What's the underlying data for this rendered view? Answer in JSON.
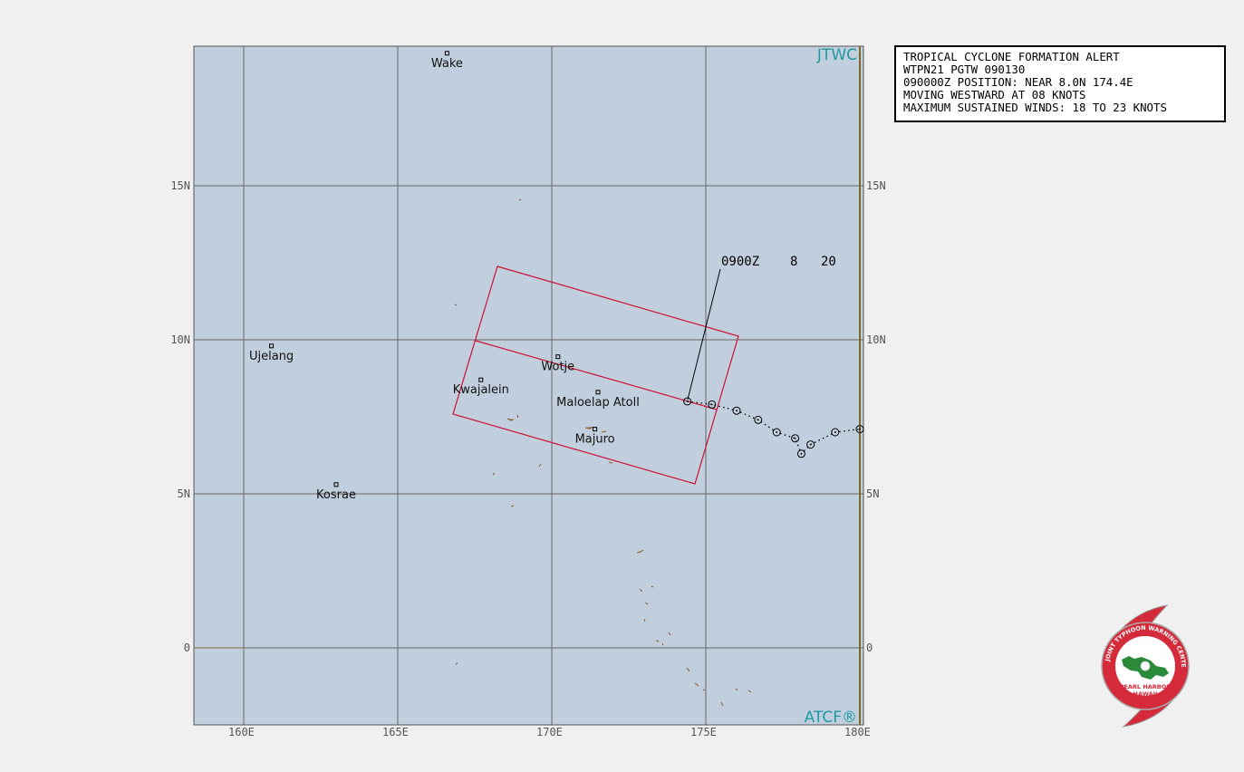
{
  "map": {
    "brand_top": "JTWC",
    "brand_bottom": "ATCF®",
    "colors": {
      "ocean": "#c0cedd",
      "background": "#f0f0f0",
      "grid": "#666666",
      "alert_area": "#cc1133",
      "land": "#8a5a2a"
    },
    "lon_ticks": [
      "160E",
      "165E",
      "170E",
      "175E",
      "180E"
    ],
    "lat_ticks_left": [
      "15N",
      "10N",
      "5N",
      "0"
    ],
    "lat_ticks_right": [
      "15N",
      "10N",
      "5N",
      "0"
    ],
    "places": [
      {
        "name": "Wake",
        "lat": 19.3,
        "lon": 166.6
      },
      {
        "name": "Ujelang",
        "lat": 9.8,
        "lon": 160.9
      },
      {
        "name": "Wotje",
        "lat": 9.45,
        "lon": 170.2
      },
      {
        "name": "Kwajalein",
        "lat": 8.7,
        "lon": 167.7
      },
      {
        "name": "Maloelap Atoll",
        "lat": 8.3,
        "lon": 171.5
      },
      {
        "name": "Majuro",
        "lat": 7.1,
        "lon": 171.4
      },
      {
        "name": "Kosrae",
        "lat": 5.3,
        "lon": 163.0
      }
    ],
    "track": [
      {
        "lat": 8.0,
        "lon": 174.4
      },
      {
        "lat": 7.9,
        "lon": 175.2
      },
      {
        "lat": 7.7,
        "lon": 176.0
      },
      {
        "lat": 7.4,
        "lon": 176.7
      },
      {
        "lat": 7.0,
        "lon": 177.3
      },
      {
        "lat": 6.8,
        "lon": 177.9
      },
      {
        "lat": 6.3,
        "lon": 178.1
      },
      {
        "lat": 6.6,
        "lon": 178.4
      },
      {
        "lat": 7.0,
        "lon": 179.2
      },
      {
        "lat": 7.1,
        "lon": 180.0
      }
    ],
    "fix_label": {
      "time": "0900Z",
      "lat_value": "8",
      "wind_value": "20"
    }
  },
  "alert": {
    "line1": "TROPICAL CYCLONE FORMATION ALERT",
    "line2": "WTPN21 PGTW 090130",
    "line3": "090000Z POSITION: NEAR 8.0N 174.4E",
    "line4": "MOVING WESTWARD AT 08 KNOTS",
    "line5": "MAXIMUM SUSTAINED WINDS: 18 TO 23 KNOTS"
  },
  "seal": {
    "name": "JOINT TYPHOON WARNING CENTER",
    "location": "PEARL HARBOR",
    "state": "HAWAII"
  }
}
